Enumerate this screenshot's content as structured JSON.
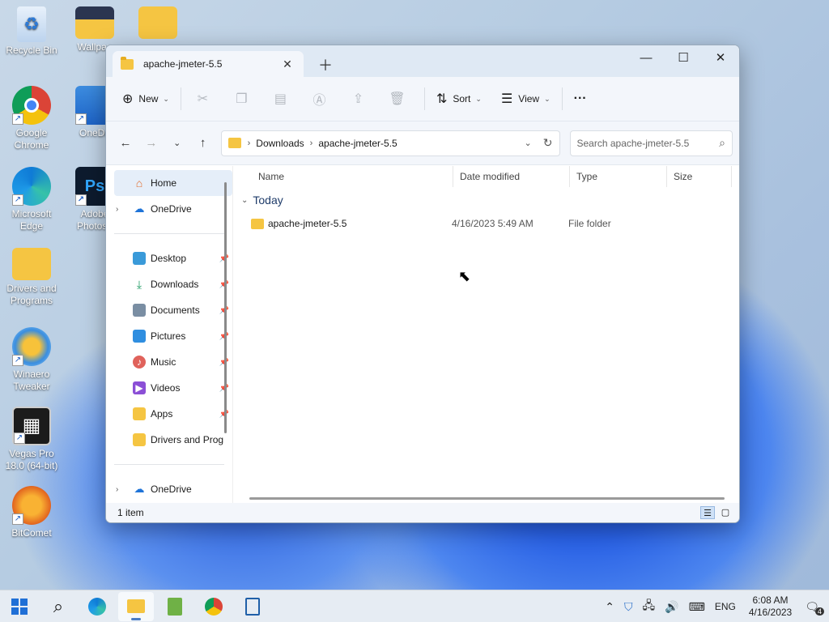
{
  "desktop": {
    "icons": [
      {
        "label": "Recycle Bin"
      },
      {
        "label": "Wallpap"
      },
      {
        "label": ""
      },
      {
        "label": "Google Chrome"
      },
      {
        "label": "OneDri"
      },
      {
        "label": "Microsoft Edge"
      },
      {
        "label": "Adobe Photosh"
      },
      {
        "label": "Drivers and Programs"
      },
      {
        "label": "Winaero Tweaker"
      },
      {
        "label": "Vegas Pro 18.0 (64-bit)"
      },
      {
        "label": "BitComet"
      }
    ]
  },
  "window": {
    "tab_title": "apache-jmeter-5.5",
    "toolbar": {
      "new": "New",
      "sort": "Sort",
      "view": "View",
      "more": "···"
    },
    "address": {
      "crumbs": [
        "Downloads",
        "apache-jmeter-5.5"
      ]
    },
    "search_placeholder": "Search apache-jmeter-5.5",
    "nav": {
      "home": "Home",
      "onedrive_top": "OneDrive",
      "pinned": [
        "Desktop",
        "Downloads",
        "Documents",
        "Pictures",
        "Music",
        "Videos",
        "Apps",
        "Drivers and Prog"
      ],
      "onedrive_bottom": "OneDrive"
    },
    "columns": {
      "name": "Name",
      "date": "Date modified",
      "type": "Type",
      "size": "Size"
    },
    "group": "Today",
    "rows": [
      {
        "name": "apache-jmeter-5.5",
        "date": "4/16/2023 5:49 AM",
        "type": "File folder"
      }
    ],
    "status": "1 item"
  },
  "taskbar": {
    "lang": "ENG",
    "time": "6:08 AM",
    "date": "4/16/2023",
    "notif_count": "4"
  }
}
